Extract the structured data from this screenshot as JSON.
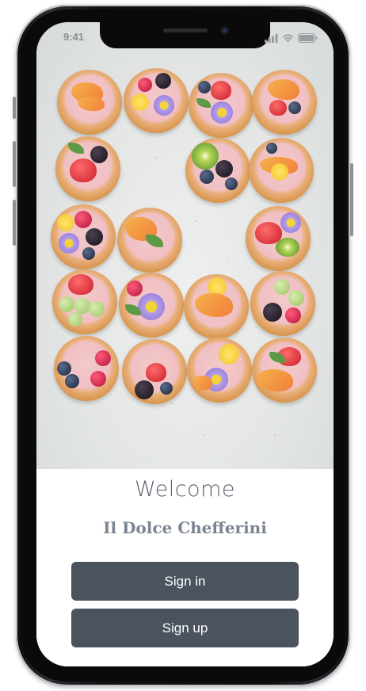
{
  "status_bar": {
    "time": "9:41",
    "icons": [
      "signal-icon",
      "wifi-icon",
      "battery-icon"
    ]
  },
  "hero": {
    "image_content": "cake-tarts-photo"
  },
  "welcome": {
    "title": "Welcome",
    "brand": "Il Dolce Chefferini"
  },
  "actions": {
    "sign_in_label": "Sign in",
    "sign_up_label": "Sign up"
  },
  "colors": {
    "button_bg": "#4b535e",
    "button_text": "#ffffff",
    "title_color": "#5a6370",
    "brand_color": "#7a8491"
  }
}
